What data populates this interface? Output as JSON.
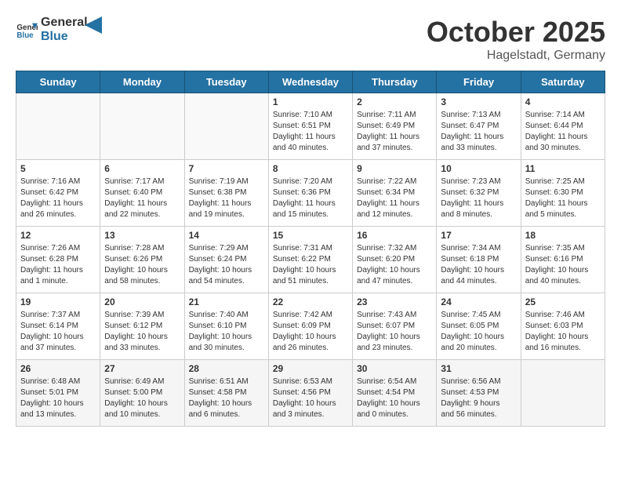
{
  "header": {
    "logo_general": "General",
    "logo_blue": "Blue",
    "month": "October 2025",
    "location": "Hagelstadt, Germany"
  },
  "weekdays": [
    "Sunday",
    "Monday",
    "Tuesday",
    "Wednesday",
    "Thursday",
    "Friday",
    "Saturday"
  ],
  "weeks": [
    [
      {
        "day": "",
        "info": ""
      },
      {
        "day": "",
        "info": ""
      },
      {
        "day": "",
        "info": ""
      },
      {
        "day": "1",
        "info": "Sunrise: 7:10 AM\nSunset: 6:51 PM\nDaylight: 11 hours\nand 40 minutes."
      },
      {
        "day": "2",
        "info": "Sunrise: 7:11 AM\nSunset: 6:49 PM\nDaylight: 11 hours\nand 37 minutes."
      },
      {
        "day": "3",
        "info": "Sunrise: 7:13 AM\nSunset: 6:47 PM\nDaylight: 11 hours\nand 33 minutes."
      },
      {
        "day": "4",
        "info": "Sunrise: 7:14 AM\nSunset: 6:44 PM\nDaylight: 11 hours\nand 30 minutes."
      }
    ],
    [
      {
        "day": "5",
        "info": "Sunrise: 7:16 AM\nSunset: 6:42 PM\nDaylight: 11 hours\nand 26 minutes."
      },
      {
        "day": "6",
        "info": "Sunrise: 7:17 AM\nSunset: 6:40 PM\nDaylight: 11 hours\nand 22 minutes."
      },
      {
        "day": "7",
        "info": "Sunrise: 7:19 AM\nSunset: 6:38 PM\nDaylight: 11 hours\nand 19 minutes."
      },
      {
        "day": "8",
        "info": "Sunrise: 7:20 AM\nSunset: 6:36 PM\nDaylight: 11 hours\nand 15 minutes."
      },
      {
        "day": "9",
        "info": "Sunrise: 7:22 AM\nSunset: 6:34 PM\nDaylight: 11 hours\nand 12 minutes."
      },
      {
        "day": "10",
        "info": "Sunrise: 7:23 AM\nSunset: 6:32 PM\nDaylight: 11 hours\nand 8 minutes."
      },
      {
        "day": "11",
        "info": "Sunrise: 7:25 AM\nSunset: 6:30 PM\nDaylight: 11 hours\nand 5 minutes."
      }
    ],
    [
      {
        "day": "12",
        "info": "Sunrise: 7:26 AM\nSunset: 6:28 PM\nDaylight: 11 hours\nand 1 minute."
      },
      {
        "day": "13",
        "info": "Sunrise: 7:28 AM\nSunset: 6:26 PM\nDaylight: 10 hours\nand 58 minutes."
      },
      {
        "day": "14",
        "info": "Sunrise: 7:29 AM\nSunset: 6:24 PM\nDaylight: 10 hours\nand 54 minutes."
      },
      {
        "day": "15",
        "info": "Sunrise: 7:31 AM\nSunset: 6:22 PM\nDaylight: 10 hours\nand 51 minutes."
      },
      {
        "day": "16",
        "info": "Sunrise: 7:32 AM\nSunset: 6:20 PM\nDaylight: 10 hours\nand 47 minutes."
      },
      {
        "day": "17",
        "info": "Sunrise: 7:34 AM\nSunset: 6:18 PM\nDaylight: 10 hours\nand 44 minutes."
      },
      {
        "day": "18",
        "info": "Sunrise: 7:35 AM\nSunset: 6:16 PM\nDaylight: 10 hours\nand 40 minutes."
      }
    ],
    [
      {
        "day": "19",
        "info": "Sunrise: 7:37 AM\nSunset: 6:14 PM\nDaylight: 10 hours\nand 37 minutes."
      },
      {
        "day": "20",
        "info": "Sunrise: 7:39 AM\nSunset: 6:12 PM\nDaylight: 10 hours\nand 33 minutes."
      },
      {
        "day": "21",
        "info": "Sunrise: 7:40 AM\nSunset: 6:10 PM\nDaylight: 10 hours\nand 30 minutes."
      },
      {
        "day": "22",
        "info": "Sunrise: 7:42 AM\nSunset: 6:09 PM\nDaylight: 10 hours\nand 26 minutes."
      },
      {
        "day": "23",
        "info": "Sunrise: 7:43 AM\nSunset: 6:07 PM\nDaylight: 10 hours\nand 23 minutes."
      },
      {
        "day": "24",
        "info": "Sunrise: 7:45 AM\nSunset: 6:05 PM\nDaylight: 10 hours\nand 20 minutes."
      },
      {
        "day": "25",
        "info": "Sunrise: 7:46 AM\nSunset: 6:03 PM\nDaylight: 10 hours\nand 16 minutes."
      }
    ],
    [
      {
        "day": "26",
        "info": "Sunrise: 6:48 AM\nSunset: 5:01 PM\nDaylight: 10 hours\nand 13 minutes."
      },
      {
        "day": "27",
        "info": "Sunrise: 6:49 AM\nSunset: 5:00 PM\nDaylight: 10 hours\nand 10 minutes."
      },
      {
        "day": "28",
        "info": "Sunrise: 6:51 AM\nSunset: 4:58 PM\nDaylight: 10 hours\nand 6 minutes."
      },
      {
        "day": "29",
        "info": "Sunrise: 6:53 AM\nSunset: 4:56 PM\nDaylight: 10 hours\nand 3 minutes."
      },
      {
        "day": "30",
        "info": "Sunrise: 6:54 AM\nSunset: 4:54 PM\nDaylight: 10 hours\nand 0 minutes."
      },
      {
        "day": "31",
        "info": "Sunrise: 6:56 AM\nSunset: 4:53 PM\nDaylight: 9 hours\nand 56 minutes."
      },
      {
        "day": "",
        "info": ""
      }
    ]
  ]
}
